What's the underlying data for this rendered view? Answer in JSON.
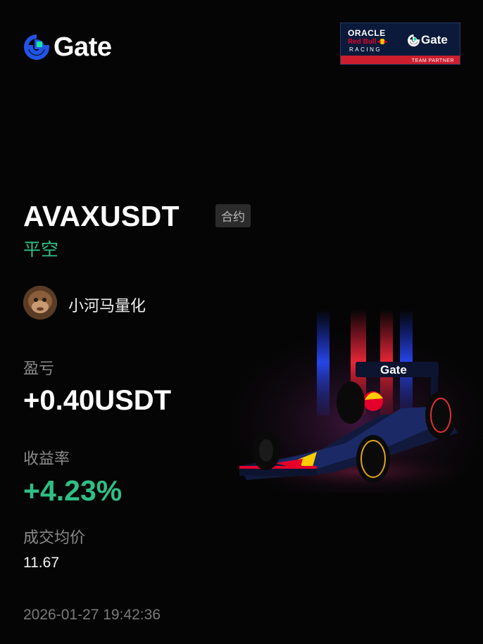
{
  "brand": {
    "name": "Gate",
    "accent": "#2354e6",
    "accent_secondary": "#17e5a0"
  },
  "partner": {
    "oracle": "ORACLE",
    "redbull": "Red Bull",
    "racing": "RACING",
    "gate": "Gate",
    "label": "TEAM PARTNER"
  },
  "trade": {
    "pair": "AVAXUSDT",
    "type_tag": "合约",
    "side": "平空"
  },
  "user": {
    "name": "小河马量化"
  },
  "stats": {
    "pnl_label": "盈亏",
    "pnl_value": "+0.40USDT",
    "roi_label": "收益率",
    "roi_value": "+4.23%",
    "avg_price_label": "成交均价",
    "avg_price_value": "11.67"
  },
  "timestamp": "2026-01-27 19:42:36",
  "car": {
    "nose_text": "Gate"
  },
  "colors": {
    "positive": "#2fbf86",
    "muted": "#8a8a8a",
    "background": "#050505"
  }
}
